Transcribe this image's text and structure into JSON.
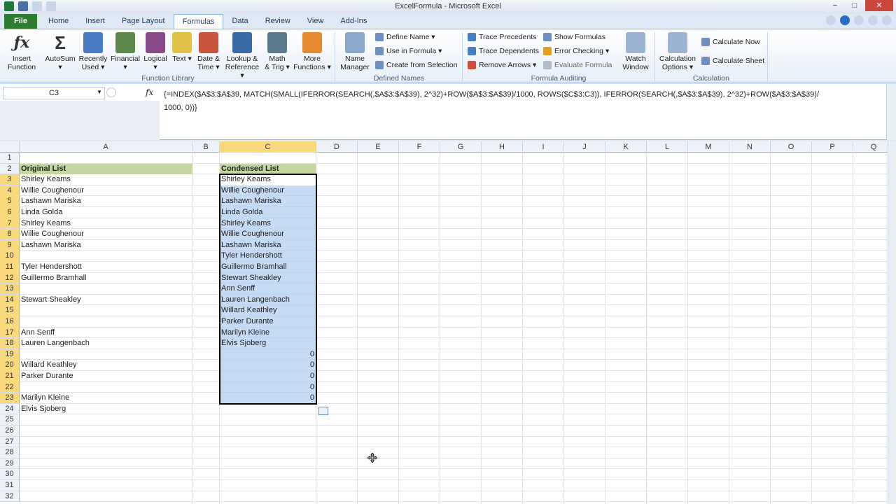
{
  "window": {
    "title": "ExcelFormula - Microsoft Excel",
    "controls": [
      "−",
      "□",
      "✕"
    ]
  },
  "tabs": [
    "File",
    "Home",
    "Insert",
    "Page Layout",
    "Formulas",
    "Data",
    "Review",
    "View",
    "Add-Ins"
  ],
  "active_tab": "Formulas",
  "ribbon": {
    "function_library": {
      "label": "Function Library",
      "buttons": [
        {
          "label": "Insert\nFunction",
          "icon": "fx-icon"
        },
        {
          "label": "AutoSum ▾",
          "icon": "sigma-icon"
        },
        {
          "label": "Recently\nUsed ▾",
          "icon": "book-star-icon"
        },
        {
          "label": "Financial ▾",
          "icon": "book-green-icon"
        },
        {
          "label": "Logical ▾",
          "icon": "book-question-icon"
        },
        {
          "label": "Text ▾",
          "icon": "book-a-icon"
        },
        {
          "label": "Date &\nTime ▾",
          "icon": "book-clock-icon"
        },
        {
          "label": "Lookup &\nReference ▾",
          "icon": "book-lookup-icon"
        },
        {
          "label": "Math\n& Trig ▾",
          "icon": "book-theta-icon"
        },
        {
          "label": "More\nFunctions ▾",
          "icon": "books-icon"
        }
      ]
    },
    "defined_names": {
      "label": "Defined Names",
      "name_manager": "Name\nManager",
      "items": [
        "Define Name ▾",
        "Use in Formula ▾",
        "Create from Selection"
      ]
    },
    "formula_auditing": {
      "label": "Formula Auditing",
      "items_left": [
        "Trace Precedents",
        "Trace Dependents",
        "Remove Arrows ▾"
      ],
      "items_right": [
        "Show Formulas",
        "Error Checking ▾",
        "Evaluate Formula"
      ],
      "watch_window": "Watch\nWindow"
    },
    "calculation": {
      "label": "Calculation",
      "options": "Calculation\nOptions ▾",
      "items": [
        "Calculate Now",
        "Calculate Sheet"
      ]
    }
  },
  "formula_bar": {
    "name_box": "C3",
    "fx": "fx",
    "formula_line1": "{=INDEX($A$3:$A$39, MATCH(SMALL(IFERROR(SEARCH(,$A$3:$A$39), 2^32)+ROW($A$3:$A$39)/1000, ROWS($C$3:C3)), IFERROR(SEARCH(,$A$3:$A$39), 2^32)+ROW($A$3:$A$39)/",
    "formula_line2": "1000, 0))}"
  },
  "grid": {
    "columns": [
      "A",
      "B",
      "C",
      "D",
      "E",
      "F",
      "G",
      "H",
      "I",
      "J",
      "K",
      "L",
      "M",
      "N",
      "O",
      "P",
      "Q"
    ],
    "selected_column": "C",
    "rows": [
      "1",
      "2",
      "3",
      "4",
      "5",
      "6",
      "7",
      "8",
      "9",
      "10",
      "11",
      "12",
      "13",
      "14",
      "15",
      "16",
      "17",
      "18",
      "19",
      "20",
      "21",
      "22",
      "23",
      "24",
      "25",
      "26",
      "27",
      "28",
      "29",
      "30",
      "31",
      "32"
    ],
    "original_list_header": "Original List",
    "condensed_list_header": "Condensed List",
    "original_list": [
      "Shirley Keams",
      "Willie Coughenour",
      "Lashawn Mariska",
      "Linda Golda",
      "Shirley Keams",
      "Willie Coughenour",
      "Lashawn Mariska",
      "",
      "Tyler Hendershott",
      "Guillermo Bramhall",
      "",
      "Stewart Sheakley",
      "",
      "",
      "Ann Senff",
      "Lauren Langenbach",
      "",
      "Willard Keathley",
      "Parker Durante",
      "",
      "Marilyn Kleine",
      "Elvis Sjoberg"
    ],
    "condensed_list": [
      "Shirley Keams",
      "Willie Coughenour",
      "Lashawn Mariska",
      "Linda Golda",
      "Shirley Keams",
      "Willie Coughenour",
      "Lashawn Mariska",
      "Tyler Hendershott",
      "Guillermo Bramhall",
      "Stewart Sheakley",
      "Ann Senff",
      "Lauren Langenbach",
      "Willard Keathley",
      "Parker Durante",
      "Marilyn Kleine",
      "Elvis Sjoberg",
      "0",
      "0",
      "0",
      "0",
      "0"
    ]
  },
  "colors": {
    "file_tab": "#2e7d32",
    "header_fill": "#c4d7a0",
    "selection_fill": "#b4cdf0",
    "selected_header": "#f9d97b"
  }
}
